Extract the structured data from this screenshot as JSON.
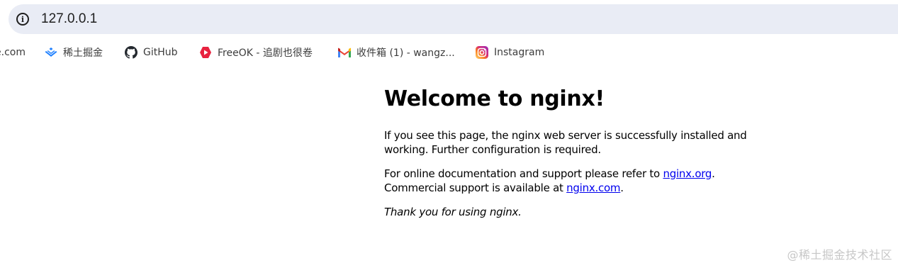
{
  "browser": {
    "url": "127.0.0.1",
    "site_info_icon": "info-icon"
  },
  "bookmarks": [
    {
      "label": "e.com",
      "icon": "truncated-favicon"
    },
    {
      "label": "稀土掘金",
      "icon": "juejin-icon"
    },
    {
      "label": "GitHub",
      "icon": "github-icon"
    },
    {
      "label": "FreeOK - 追剧也很卷",
      "icon": "freeok-icon"
    },
    {
      "label": "收件箱 (1) - wangz...",
      "icon": "gmail-icon"
    },
    {
      "label": "Instagram",
      "icon": "instagram-icon"
    }
  ],
  "page": {
    "heading": "Welcome to nginx!",
    "paragraph1": "If you see this page, the nginx web server is successfully installed and working. Further configuration is required.",
    "p2_text1": "For online documentation and support please refer to ",
    "p2_link1": "nginx.org",
    "p2_text2": ".",
    "p2_text3": "Commercial support is available at ",
    "p2_link2": "nginx.com",
    "p2_text4": ".",
    "thanks": "Thank you for using nginx."
  },
  "watermark": "@稀土掘金技术社区",
  "colors": {
    "omnibox_bg": "#e9ecf5",
    "link": "#0000ee",
    "juejin": "#1e80ff",
    "freeok": "#e8223f"
  }
}
